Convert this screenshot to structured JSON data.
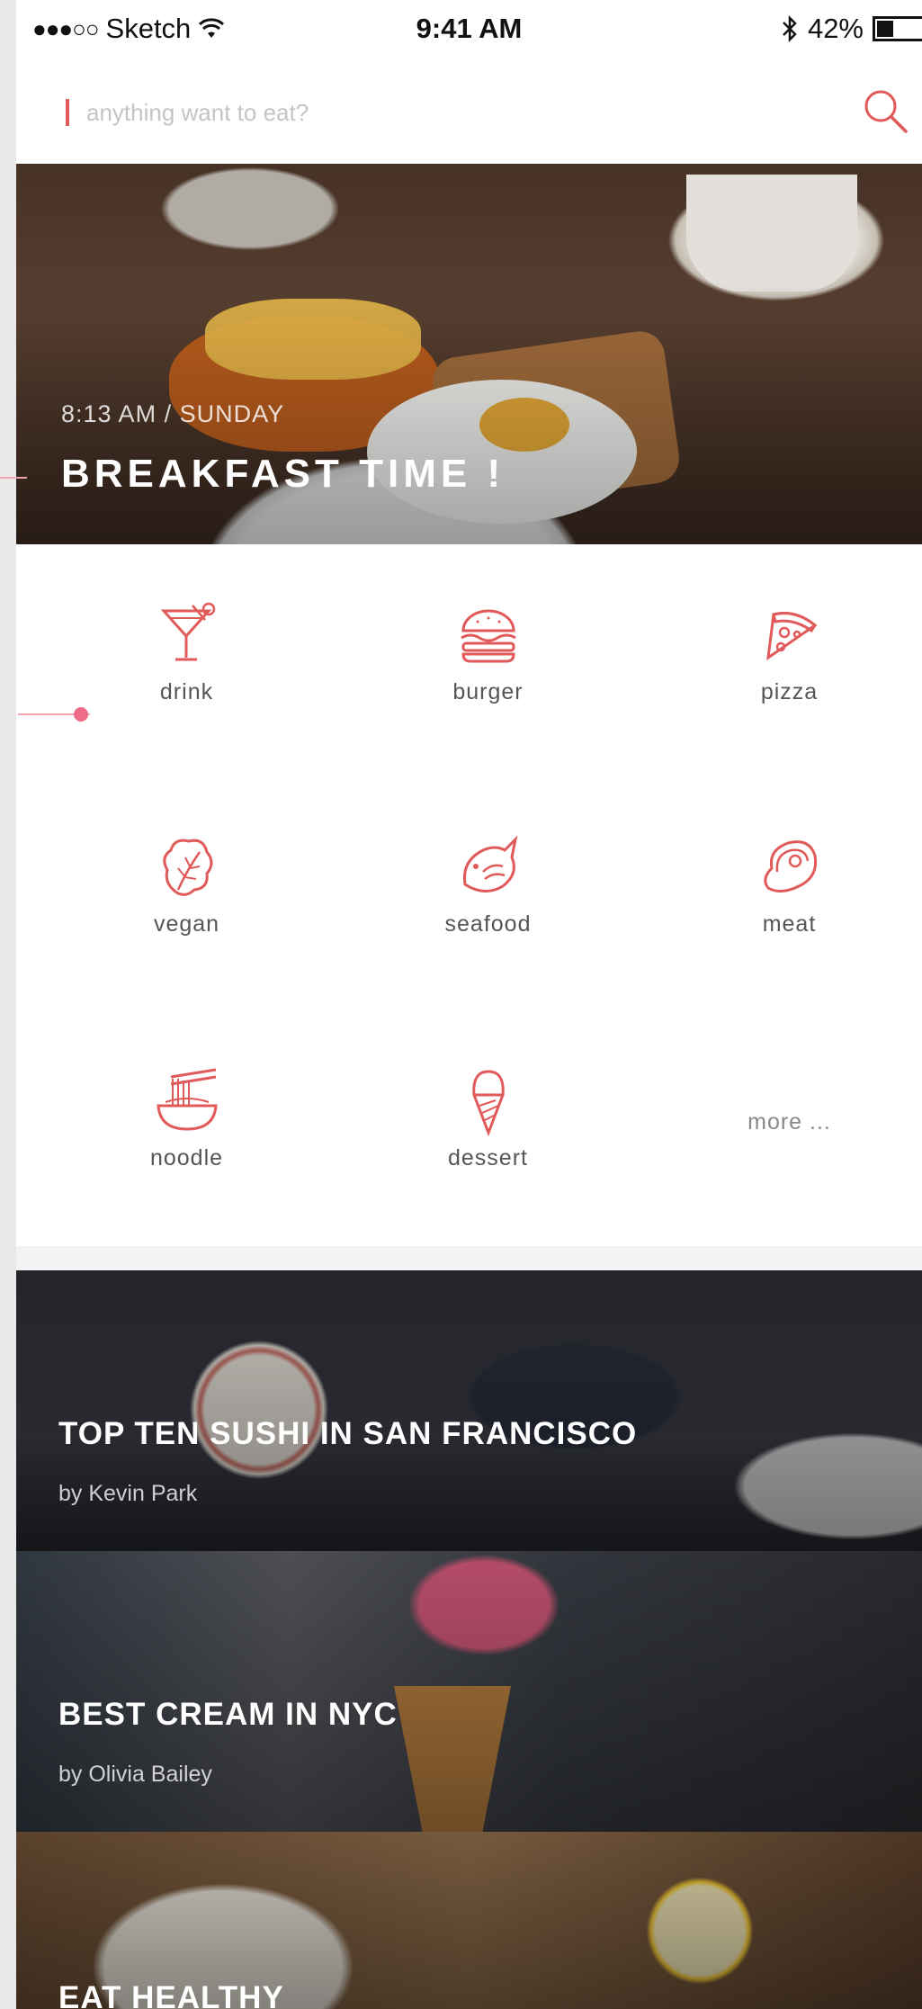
{
  "status_bar": {
    "signal": "●●●○○",
    "carrier": "Sketch",
    "time": "9:41 AM",
    "battery_percent": "42%",
    "battery_level": 0.42
  },
  "search": {
    "placeholder": "anything want to eat?",
    "value": ""
  },
  "hero": {
    "subtitle": "8:13 AM / SUNDAY",
    "title": "BREAKFAST TIME !"
  },
  "categories": [
    {
      "label": "drink",
      "icon": "cocktail-icon"
    },
    {
      "label": "burger",
      "icon": "burger-icon"
    },
    {
      "label": "pizza",
      "icon": "pizza-icon"
    },
    {
      "label": "vegan",
      "icon": "lettuce-icon"
    },
    {
      "label": "seafood",
      "icon": "fish-icon"
    },
    {
      "label": "meat",
      "icon": "steak-icon"
    },
    {
      "label": "noodle",
      "icon": "noodle-bowl-icon"
    },
    {
      "label": "dessert",
      "icon": "ice-cream-icon"
    },
    {
      "label": "more ...",
      "icon": ""
    }
  ],
  "articles": [
    {
      "title": "TOP TEN SUSHI IN SAN FRANCISCO",
      "author": "by Kevin Park"
    },
    {
      "title": "BEST CREAM IN NYC",
      "author": "by Olivia Bailey"
    },
    {
      "title": "EAT HEALTHY",
      "author": ""
    }
  ],
  "colors": {
    "accent": "#e15a5a",
    "text_gray": "#555555",
    "placeholder": "#c4c4c4"
  }
}
